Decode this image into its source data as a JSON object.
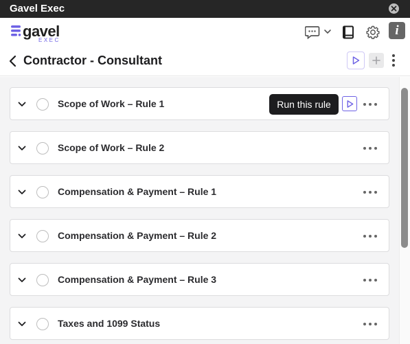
{
  "window": {
    "title": "Gavel Exec"
  },
  "brand": {
    "name": "gavel",
    "sub": "EXEC",
    "accent": "#6e62e5"
  },
  "header": {
    "icons": [
      "chat-icon",
      "book-icon",
      "gear-icon",
      "info-icon"
    ],
    "info_glyph": "i"
  },
  "page": {
    "title": "Contractor - Consultant"
  },
  "tooltip": {
    "text": "Run this rule"
  },
  "rules": [
    {
      "name": "Scope of Work – Rule 1"
    },
    {
      "name": "Scope of Work – Rule 2"
    },
    {
      "name": "Compensation & Payment – Rule 1"
    },
    {
      "name": "Compensation & Payment – Rule 2"
    },
    {
      "name": "Compensation & Payment – Rule 3"
    },
    {
      "name": "Taxes and 1099 Status"
    }
  ]
}
